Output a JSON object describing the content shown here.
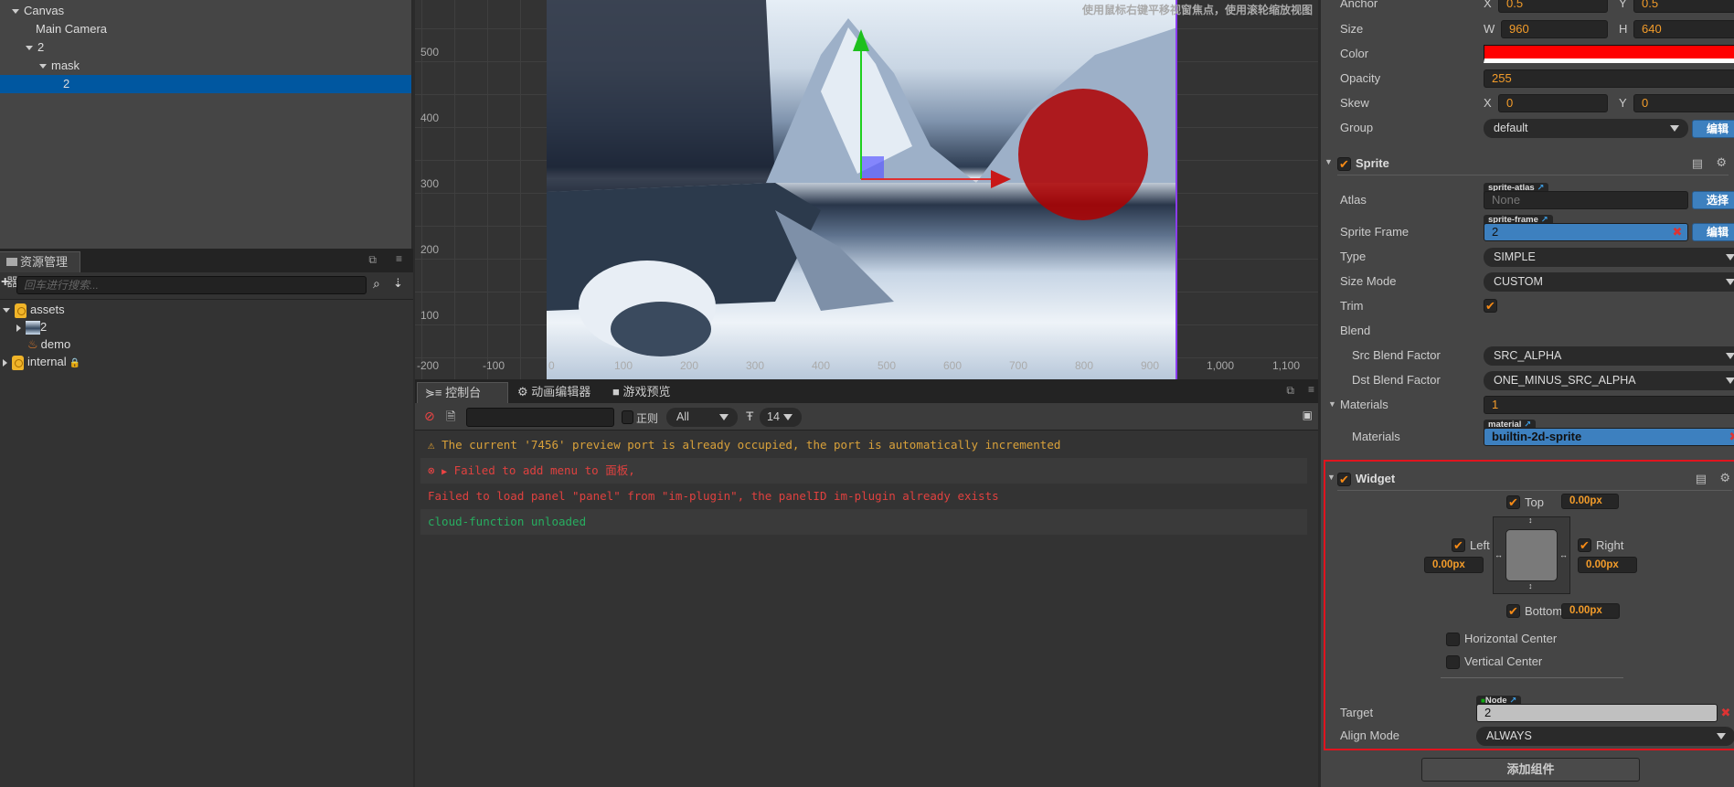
{
  "hierarchy": {
    "items": [
      {
        "label": "Canvas",
        "expanded": true
      },
      {
        "label": "Main Camera"
      },
      {
        "label": "2",
        "expanded": true
      },
      {
        "label": "mask",
        "expanded": true
      },
      {
        "label": "2",
        "selected": true
      }
    ]
  },
  "assets": {
    "tab": "资源管理器",
    "search_placeholder": "回车进行搜索...",
    "items": [
      {
        "label": "assets"
      },
      {
        "label": "2"
      },
      {
        "label": "demo"
      },
      {
        "label": "internal"
      }
    ]
  },
  "scene": {
    "hint": "使用鼠标右键平移视窗焦点，使用滚轮缩放视图",
    "y_ticks": [
      "500",
      "400",
      "300",
      "200",
      "100"
    ],
    "x_ticks": [
      "-200",
      "-100",
      "0",
      "100",
      "200",
      "300",
      "400",
      "500",
      "600",
      "700",
      "800",
      "900",
      "1,000",
      "1,100"
    ]
  },
  "console": {
    "tabs": [
      "控制台",
      "动画编辑器",
      "游戏预览"
    ],
    "regex_label": "正则",
    "level": "All",
    "font_size": "14",
    "messages": [
      {
        "type": "warning",
        "text": "The current '7456' preview port is already occupied, the port is automatically incremented",
        "color": "#d9a13a"
      },
      {
        "type": "error",
        "text": "Failed to add menu to 面板,",
        "color": "#e0413f"
      },
      {
        "type": "error-plain",
        "text": "Failed to load panel \"panel\" from \"im-plugin\", the panelID im-plugin already exists",
        "color": "#e0413f"
      },
      {
        "type": "info",
        "text": "cloud-function unloaded",
        "color": "#27ae60"
      }
    ]
  },
  "inspector": {
    "anchor": {
      "label": "Anchor",
      "x": "0.5",
      "y": "0.5"
    },
    "size": {
      "label": "Size",
      "w": "960",
      "h": "640"
    },
    "color": {
      "label": "Color",
      "value": "#ff0000"
    },
    "opacity": {
      "label": "Opacity",
      "value": "255"
    },
    "skew": {
      "label": "Skew",
      "x": "0",
      "y": "0"
    },
    "group": {
      "label": "Group",
      "value": "default",
      "edit": "编辑"
    },
    "axis": {
      "x": "X",
      "y": "Y",
      "w": "W",
      "h": "H"
    },
    "sprite": {
      "title": "Sprite",
      "enabled": true,
      "atlas": {
        "label": "Atlas",
        "tag": "sprite-atlas",
        "value": "None",
        "button": "选择"
      },
      "frame": {
        "label": "Sprite Frame",
        "tag": "sprite-frame",
        "value": "2",
        "button": "编辑"
      },
      "type": {
        "label": "Type",
        "value": "SIMPLE"
      },
      "size_mode": {
        "label": "Size Mode",
        "value": "CUSTOM"
      },
      "trim": {
        "label": "Trim",
        "checked": true
      },
      "blend": {
        "label": "Blend"
      },
      "src": {
        "label": "Src Blend Factor",
        "value": "SRC_ALPHA"
      },
      "dst": {
        "label": "Dst Blend Factor",
        "value": "ONE_MINUS_SRC_ALPHA"
      },
      "materials_count": {
        "label": "Materials",
        "value": "1"
      },
      "material": {
        "label": "Materials",
        "tag": "material",
        "value": "builtin-2d-sprite"
      }
    },
    "widget": {
      "title": "Widget",
      "enabled": true,
      "top": {
        "label": "Top",
        "value": "0.00px"
      },
      "left": {
        "label": "Left",
        "value": "0.00px"
      },
      "right": {
        "label": "Right",
        "value": "0.00px"
      },
      "bottom": {
        "label": "Bottom",
        "value": "0.00px"
      },
      "hcenter": {
        "label": "Horizontal Center",
        "checked": false
      },
      "vcenter": {
        "label": "Vertical Center",
        "checked": false
      },
      "target": {
        "label": "Target",
        "tag": "Node",
        "value": "2"
      },
      "align": {
        "label": "Align Mode",
        "value": "ALWAYS"
      }
    },
    "add_component": "添加组件"
  }
}
